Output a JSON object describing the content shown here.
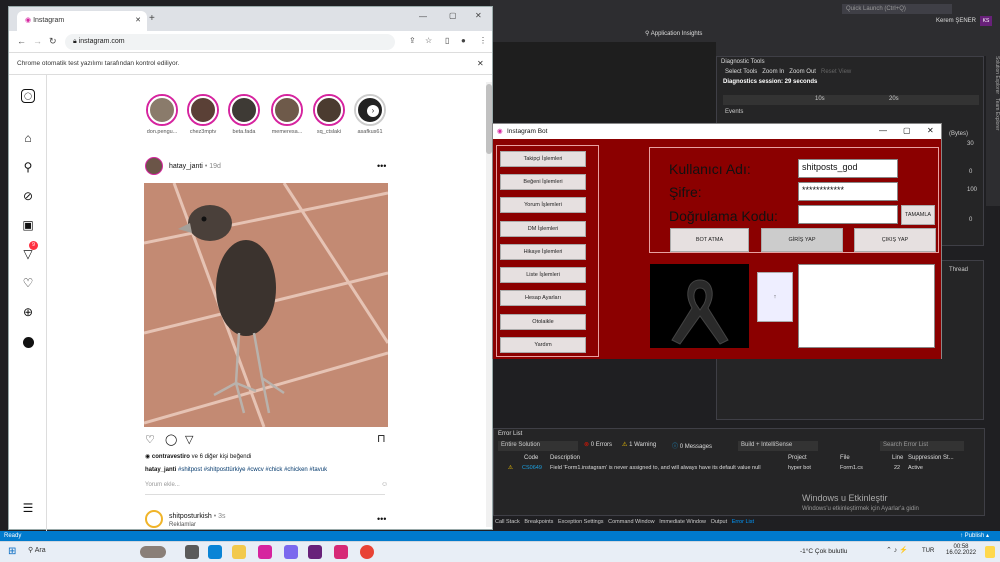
{
  "vs": {
    "quick_launch": "Quick Launch (Ctrl+Q)",
    "user": "Kerem ŞENER",
    "user_initials": "KS",
    "app_insights": "Application Insights",
    "diag": {
      "title": "Diagnostic Tools",
      "select_tools": "Select Tools",
      "zoom_in": "Zoom In",
      "zoom_out": "Zoom Out",
      "reset": "Reset View",
      "session": "Diagnostics session: 29 seconds",
      "t10": "10s",
      "t20": "20s",
      "events": "Events",
      "bytes": "(Bytes)",
      "n30": "30",
      "n0": "0",
      "n100": "100",
      "n0b": "0",
      "thread": "Thread"
    },
    "right_tabs": [
      "Solution Explorer",
      "Team Explorer"
    ],
    "errors": {
      "title": "Error List",
      "scope": "Entire Solution",
      "errors": "0 Errors",
      "warnings": "1 Warning",
      "messages": "0 Messages",
      "build": "Build + IntelliSense",
      "search": "Search Error List",
      "cols": [
        "Code",
        "Description",
        "Project",
        "File",
        "Line",
        "Suppression St..."
      ],
      "row": {
        "code": "CS0649",
        "desc": "Field 'Form1.instagram' is never assigned to, and will always have its default value null",
        "project": "hyper bot",
        "file": "Form1.cs",
        "line": "22",
        "state": "Active"
      }
    },
    "bottom_tabs": [
      "Call Stack",
      "Breakpoints",
      "Exception Settings",
      "Command Window",
      "Immediate Window",
      "Output",
      "Error List"
    ],
    "activate_title": "Windows u Etkinleştir",
    "activate_sub": "Windows'u etkinleştirmek için Ayarlar'a gidin",
    "status_ready": "Ready",
    "status_publish": "↑ Publish ▴"
  },
  "chrome": {
    "tab_title": "Instagram",
    "url": "instagram.com",
    "info": "Chrome otomatik test yazılımı tarafından kontrol ediliyor."
  },
  "ig": {
    "stories": [
      "don.pengu...",
      "chez3mptv",
      "beta.fada",
      "memeresa...",
      "sq_ctslaki",
      "asafkus61"
    ],
    "post": {
      "user": "hatay_janti",
      "time": "• 19d",
      "likes_user": "contravestiro",
      "likes_rest": "ve 6 diğer kişi beğendi",
      "caption_user": "hatay_janti",
      "caption": "#shitpost #shitposttürkiye #cwcv #chick #chicken #tavuk",
      "comment_ph": "Yorum ekle..."
    },
    "next": {
      "user": "shitposturkish",
      "time": "• 3s",
      "sub": "Reklamlar"
    },
    "notif_count": "9"
  },
  "bot": {
    "title": "Instagram Bot",
    "menu": [
      "Takipçi İşlemleri",
      "Beğeni İşlemleri",
      "Yorum İşlemleri",
      "DM İşlemleri",
      "Hikaye İşlemleri",
      "Liste İşlemleri",
      "Hesap Ayarları",
      "Otolaikle",
      "Yardım"
    ],
    "user_label": "Kullanıcı Adı:",
    "pass_label": "Şifre:",
    "code_label": "Doğrulama Kodu:",
    "user_value": "shitposts_god",
    "pass_value": "************",
    "code_value": "",
    "confirm": "TAMAMLA",
    "bot_start": "BOT ATMA",
    "login": "GİRİŞ YAP",
    "logout": "ÇIKIŞ YAP",
    "small_btn": "↑"
  },
  "taskbar": {
    "search": "Ara",
    "weather": "-1°C Çok bulutlu",
    "lang": "TUR",
    "time": "00:58",
    "date": "16.02.2022"
  }
}
